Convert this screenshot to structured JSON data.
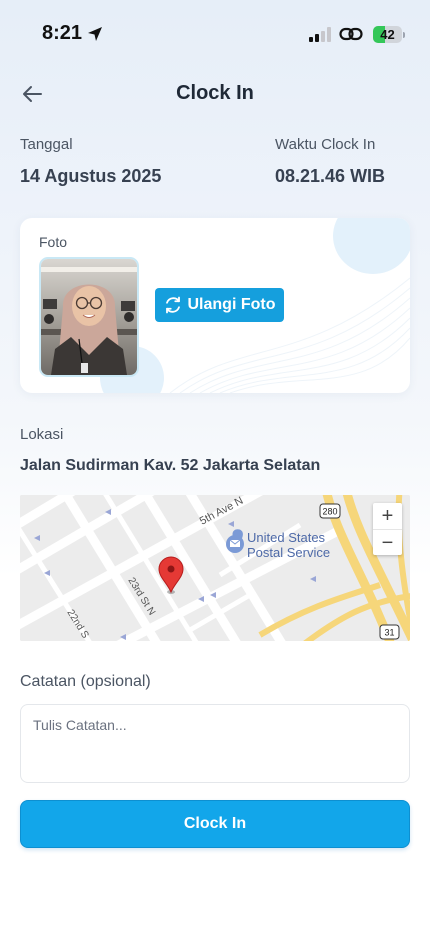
{
  "status_bar": {
    "time": "8:21",
    "battery_level": "42",
    "battery_fraction": 0.42,
    "icons": [
      "location-arrow-icon",
      "signal-icon",
      "link-icon",
      "battery-icon"
    ]
  },
  "header": {
    "title": "Clock In",
    "back_icon": "arrow-left-icon"
  },
  "info": {
    "date_label": "Tanggal",
    "date_value": "14 Agustus 2025",
    "time_label": "Waktu Clock In",
    "time_value": "08.21.46 WIB"
  },
  "photo": {
    "label": "Foto",
    "retake_label": "Ulangi Foto",
    "retake_icon": "refresh-icon"
  },
  "location": {
    "label": "Lokasi",
    "address": "Jalan Sudirman Kav. 52 Jakarta Selatan",
    "map": {
      "street_5th_ave": "5th Ave N",
      "street_23rd": "23rd St N",
      "street_22nd": "22nd S",
      "poi_line1": "United States",
      "poi_line2": "Postal Service",
      "highway_280": "280",
      "highway_31": "31",
      "zoom_in": "+",
      "zoom_out": "−"
    }
  },
  "notes": {
    "label": "Catatan (opsional)",
    "placeholder": "Tulis Catatan..."
  },
  "actions": {
    "clock_in_label": "Clock In"
  },
  "colors": {
    "primary": "#12a6ea",
    "retake_button": "#159fdd",
    "map_pin": "#e53935",
    "highway": "#f6d67a"
  }
}
